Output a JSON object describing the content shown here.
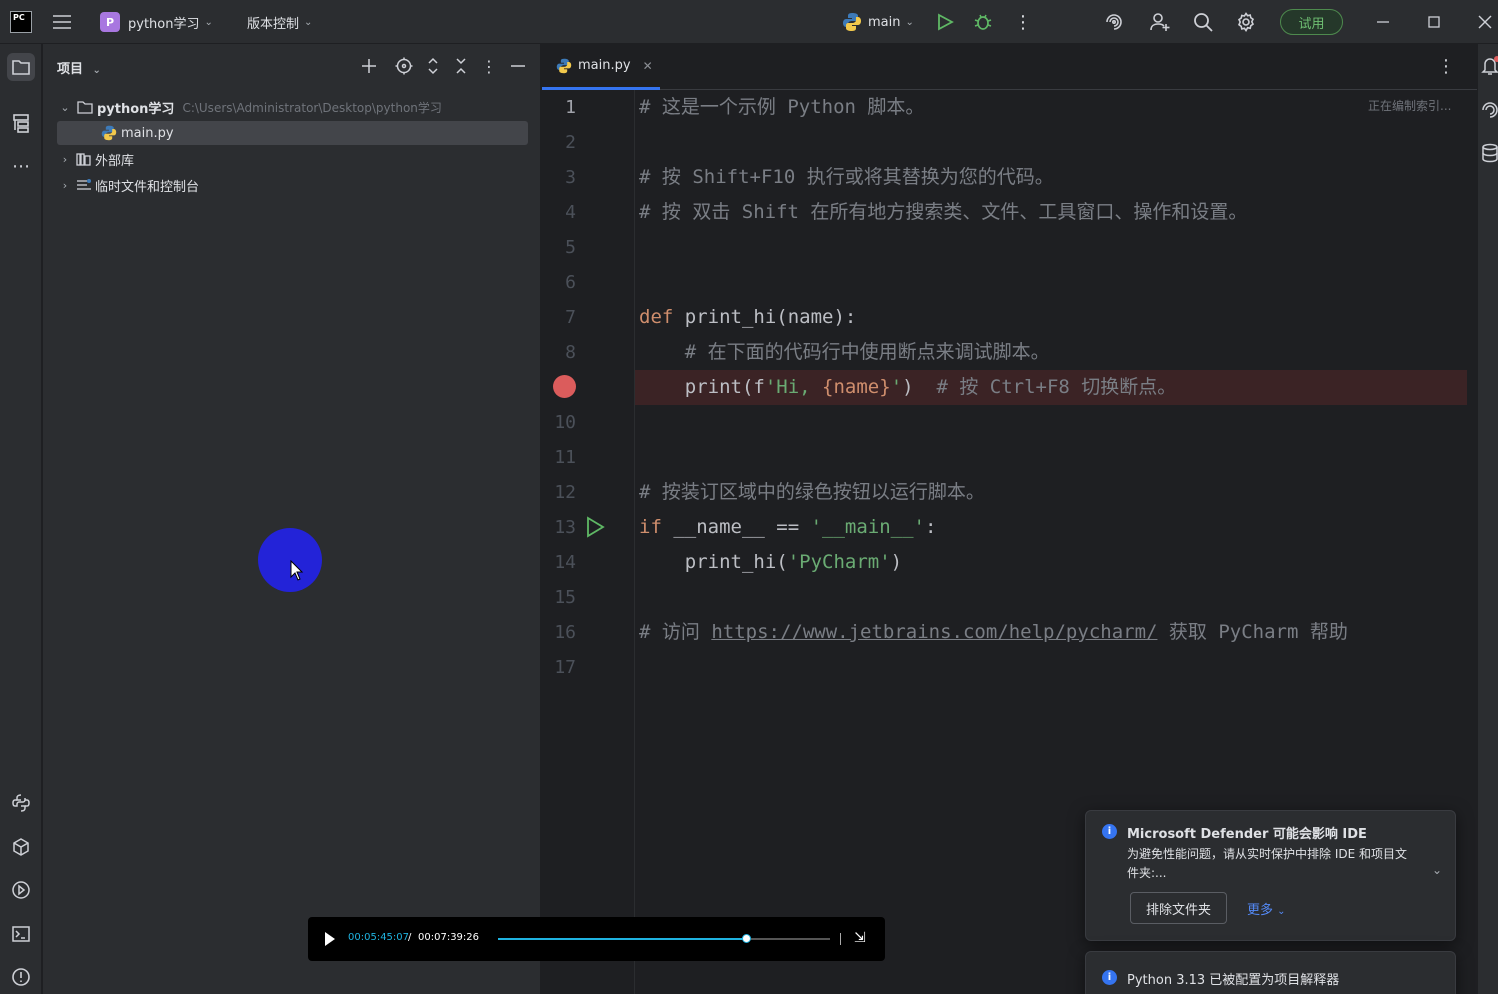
{
  "titlebar": {
    "logo": "PC",
    "project_badge": "P",
    "project_name": "python学习",
    "vcs_label": "版本控制",
    "branch": "main",
    "trial_label": "试用",
    "icons": [
      "hamburger-menu-icon",
      "run-icon",
      "debug-icon",
      "more-vertical-icon",
      "ai-assistant-icon",
      "add-user-icon",
      "search-icon",
      "settings-icon",
      "minimize-icon",
      "maximize-icon",
      "close-icon"
    ]
  },
  "left_strip": {
    "icons": [
      "folder-icon",
      "structure-icon",
      "more-horizontal-icon",
      "python-console-icon",
      "python-packages-icon",
      "services-icon",
      "terminal-icon",
      "problems-icon"
    ]
  },
  "project_panel": {
    "title": "项目",
    "tree": [
      {
        "label": "python学习",
        "path": "C:\\Users\\Administrator\\Desktop\\python学习",
        "expanded": true,
        "level": 0
      },
      {
        "label": "main.py",
        "level": 1,
        "selected": true
      },
      {
        "label": "外部库",
        "level": 0
      },
      {
        "label": "临时文件和控制台",
        "level": 0
      }
    ]
  },
  "editor": {
    "tab": "main.py",
    "indexing_status": "正在编制索引...",
    "current_line": 1,
    "breakpoint_line": 9,
    "run_line": 13,
    "line_numbers": [
      "1",
      "2",
      "3",
      "4",
      "5",
      "6",
      "7",
      "8",
      "",
      "10",
      "11",
      "12",
      "13",
      "14",
      "15",
      "16",
      "17"
    ],
    "lines": {
      "l1": "# 这是一个示例 Python 脚本。",
      "l3": "# 按 Shift+F10 执行或将其替换为您的代码。",
      "l4": "# 按 双击 Shift 在所有地方搜索类、文件、工具窗口、操作和设置。",
      "l7_kw": "def",
      "l7_rest": " print_hi(name):",
      "l8": "    # 在下面的代码行中使用断点来调试脚本。",
      "l9_code_a": "    print(f",
      "l9_str": "'Hi, ",
      "l9_var": "{name}",
      "l9_str2": "'",
      "l9_code_b": ")",
      "l9_comment": "  # 按 Ctrl+F8 切换断点。",
      "l12": "# 按装订区域中的绿色按钮以运行脚本。",
      "l13_kw": "if",
      "l13_mid": " __name__ == ",
      "l13_str": "'__main__'",
      "l13_end": ":",
      "l14_a": "    print_hi(",
      "l14_str": "'PyCharm'",
      "l14_b": ")",
      "l16_a": "# 访问 ",
      "l16_link": "https://www.jetbrains.com/help/pycharm/",
      "l16_b": " 获取 PyCharm 帮助"
    }
  },
  "notifications": [
    {
      "title": "Microsoft Defender 可能会影响 IDE",
      "body": "为避免性能问题，请从实时保护中排除 IDE 和项目文件夹:...",
      "button": "排除文件夹",
      "link": "更多"
    },
    {
      "title": "Python 3.13 已被配置为项目解释器"
    }
  ],
  "player": {
    "current_time": "00:05:45:07",
    "separator": "/",
    "total_time": "00:07:39:26",
    "progress": 0.75
  },
  "colors": {
    "accent": "#3574f0",
    "breakpoint": "#db5c5c",
    "run_green": "#5fb865",
    "cursor_highlight": "#2323d8",
    "player_accent": "#1fb3e0"
  }
}
